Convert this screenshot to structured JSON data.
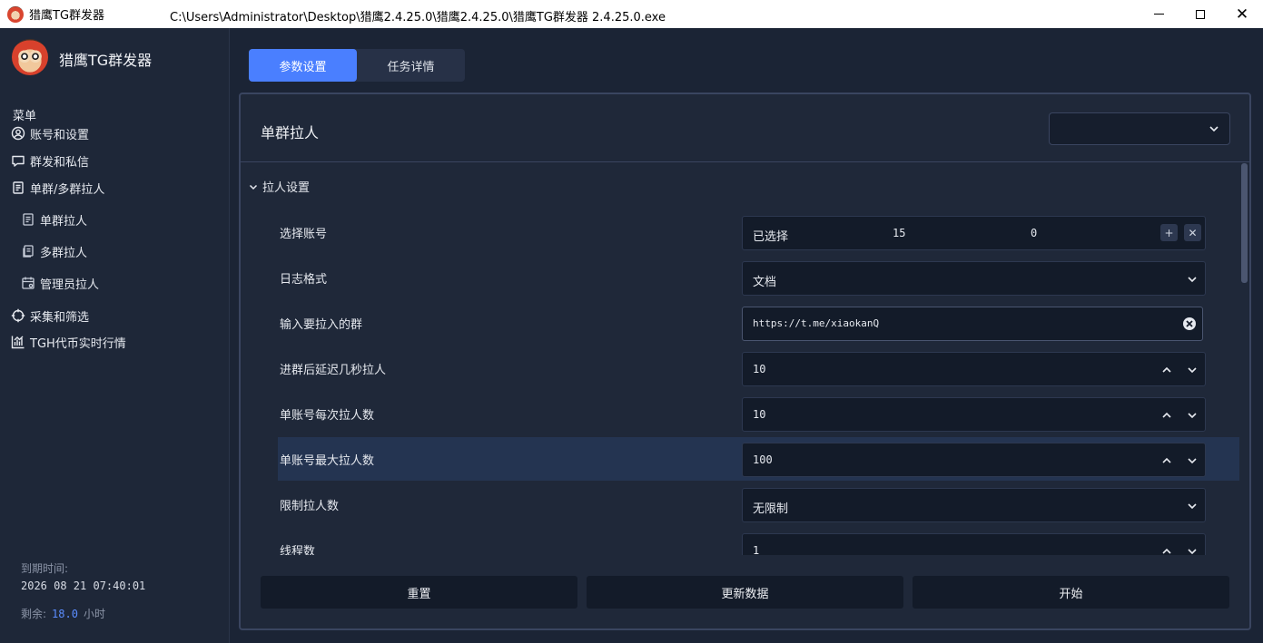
{
  "window": {
    "app_title": "猎鹰TG群发器",
    "path": "C:\\Users\\Administrator\\Desktop\\猎鹰2.4.25.0\\猎鹰2.4.25.0\\猎鹰TG群发器 2.4.25.0.exe"
  },
  "sidebar": {
    "brand": "猎鹰TG群发器",
    "menu_heading": "菜单",
    "items": [
      {
        "label": "账号和设置",
        "icon": "user-circle-icon"
      },
      {
        "label": "群发和私信",
        "icon": "chat-bubble-icon"
      },
      {
        "label": "单群/多群拉人",
        "icon": "document-icon"
      },
      {
        "label": "单群拉人",
        "icon": "document-icon"
      },
      {
        "label": "多群拉人",
        "icon": "documents-icon"
      },
      {
        "label": "管理员拉人",
        "icon": "calendar-user-icon"
      },
      {
        "label": "采集和筛选",
        "icon": "crosshair-icon"
      },
      {
        "label": "TGH代币实时行情",
        "icon": "chart-icon"
      }
    ],
    "expire_label": "到期时间:",
    "expire_value": "2026 08 21 07:40:01",
    "remain_label": "剩余:",
    "remain_value": "18.0",
    "remain_unit": "小时"
  },
  "tabs": [
    {
      "label": "参数设置",
      "active": true
    },
    {
      "label": "任务详情",
      "active": false
    }
  ],
  "panel": {
    "title": "单群拉人",
    "select_value": "",
    "section_title": "拉人设置"
  },
  "form": {
    "account": {
      "label": "选择账号",
      "text": "已选择",
      "count": "15",
      "zero": "0"
    },
    "log_format": {
      "label": "日志格式",
      "value": "文档"
    },
    "group": {
      "label": "输入要拉入的群",
      "value": "https://t.me/xiaokanQ"
    },
    "delay": {
      "label": "进群后延迟几秒拉人",
      "value": "10"
    },
    "per_time": {
      "label": "单账号每次拉人数",
      "value": "10"
    },
    "max_per_account": {
      "label": "单账号最大拉人数",
      "value": "100"
    },
    "limit": {
      "label": "限制拉人数",
      "value": "无限制"
    },
    "threads": {
      "label": "线程数",
      "value": "1"
    }
  },
  "actions": {
    "reset": "重置",
    "refresh": "更新数据",
    "start": "开始"
  },
  "colors": {
    "accent": "#4a7fff",
    "background": "#1b2435",
    "field": "#131b29",
    "highlight_row": "#243451"
  }
}
